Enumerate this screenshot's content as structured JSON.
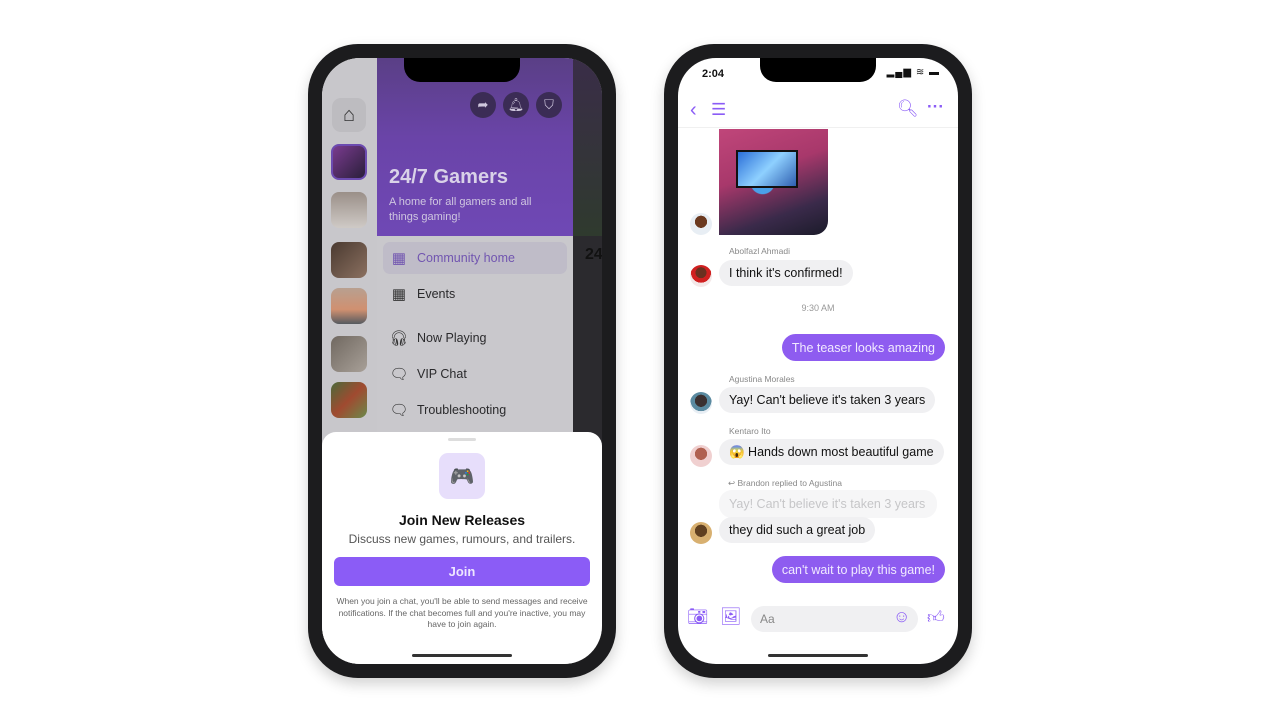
{
  "left_phone": {
    "sidebar": {
      "home_icon": "home-icon"
    },
    "header": {
      "title": "24/7 Gamers",
      "subtitle": "A home for all gamers and all things gaming!",
      "actions": [
        "share-icon",
        "bell-icon",
        "shield-icon"
      ]
    },
    "menu": [
      {
        "label": "Community home",
        "icon": "community-home-icon",
        "active": true
      },
      {
        "label": "Events",
        "icon": "calendar-icon"
      },
      {
        "label": "Now Playing",
        "icon": "audio-channel-icon"
      },
      {
        "label": "VIP Chat",
        "icon": "locked-chat-icon"
      },
      {
        "label": "Troubleshooting",
        "icon": "chat-clock-icon"
      }
    ],
    "partial_text": "24",
    "sheet": {
      "icon": "🎮",
      "title": "Join New Releases",
      "subtitle": "Discuss new games, rumours, and trailers.",
      "join_label": "Join",
      "fine_print": "When you join a chat, you'll be able to send messages and receive notifications. If the chat becomes full and you're inactive, you may have to join again."
    }
  },
  "right_phone": {
    "status_time": "2:04",
    "messages": [
      {
        "sender": "Abolfazl Ahmadi",
        "text": "I think it's confirmed!"
      },
      {
        "timestamp": "9:30 AM"
      },
      {
        "outgoing": true,
        "text": "The teaser looks amazing"
      },
      {
        "sender": "Agustina Morales",
        "text": "Yay! Can't believe it's taken 3 years"
      },
      {
        "sender": "Kentaro Ito",
        "text": "😱 Hands down most beautiful game"
      },
      {
        "reply_label": "Brandon replied to Agustina",
        "quoted": "Yay! Can't believe it's taken 3 years",
        "text": "they did such a great job"
      },
      {
        "outgoing": true,
        "text": "can't wait to play this game!"
      }
    ],
    "composer": {
      "placeholder": "Aa"
    }
  },
  "colors": {
    "accent": "#8b5cf6",
    "bubble_in": "#f0f0f2"
  }
}
